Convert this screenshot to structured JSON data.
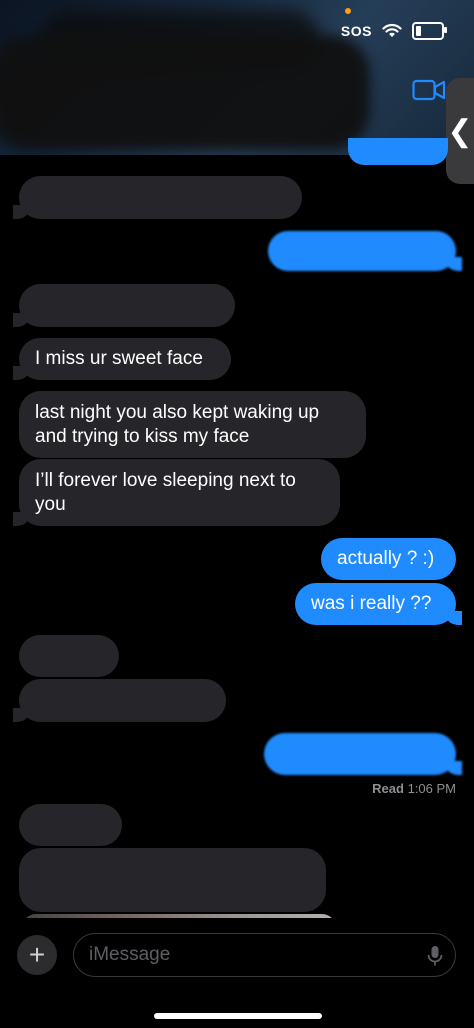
{
  "status_bar": {
    "sos": "SOS"
  },
  "messages": [
    {
      "text": "I miss ur sweet face"
    },
    {
      "text": "last night you also kept waking up and trying to kiss my face"
    },
    {
      "text": "I’ll forever love sleeping next to you"
    },
    {
      "text": "actually ? :)"
    },
    {
      "text": "was i really ??"
    }
  ],
  "read_receipt": {
    "label": "Read",
    "time": "1:06 PM"
  },
  "composer": {
    "placeholder": "iMessage",
    "plus": "+"
  },
  "colors": {
    "incoming": "#26252a",
    "outgoing": "#1f8bff",
    "background": "#000000"
  }
}
